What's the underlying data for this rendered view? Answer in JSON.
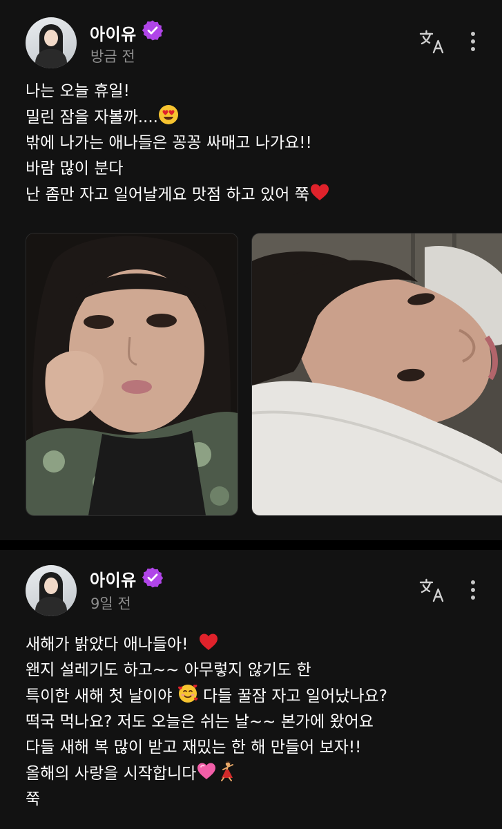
{
  "posts": [
    {
      "author": "아이유",
      "time": "방금 전",
      "lines": [
        "나는 오늘 휴일!",
        "밀린 잠을 자볼까....",
        "밖에 나가는 애나들은 꽁꽁 싸매고 나가요!!",
        "바람 많이 분다",
        "난 좀만 자고 일어날게요 맛점 하고 있어 쭉"
      ],
      "photos": [
        "selfie-resting-chin-on-hand",
        "selfie-lying-on-pillow"
      ]
    },
    {
      "author": "아이유",
      "time": "9일 전",
      "lines": [
        "새해가 밝았다 애나들아!",
        "왠지 설레기도 하고~~ 아무렇지 않기도 한",
        "특이한 새해 첫 날이야",
        "다들 꿀잠 자고 일어났나요?",
        "떡국 먹나요? 저도 오늘은 쉬는 날~~ 본가에 왔어요",
        "다들 새해 복 많이 받고 재밌는 한 해 만들어 보자!!",
        "올해의 사랑을 시작합니다",
        "쭉"
      ]
    }
  ],
  "icons": {
    "verified": "verified-badge-icon",
    "translate": "translate-icon",
    "more": "more-vertical-icon"
  },
  "colors": {
    "background": "#121212",
    "separator": "#000000",
    "badge": "#b045e8",
    "muted_text": "#8e8e8e",
    "heart": "#e0222b"
  }
}
